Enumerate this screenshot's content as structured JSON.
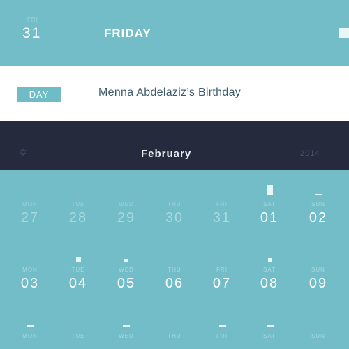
{
  "header": {
    "mini_label": "FRI",
    "date": "31",
    "weekday": "FRIDAY"
  },
  "event": {
    "tag": "DAY",
    "title": "Menna Abdelaziz’s Birthday"
  },
  "month": {
    "name": "February",
    "year": "2014",
    "icon": "star-icon"
  },
  "calendar": {
    "row1": [
      {
        "dow": "MON",
        "num": "27"
      },
      {
        "dow": "TUE",
        "num": "28"
      },
      {
        "dow": "WED",
        "num": "29"
      },
      {
        "dow": "THU",
        "num": "30"
      },
      {
        "dow": "FRI",
        "num": "31"
      },
      {
        "dow": "SAT",
        "num": "01"
      },
      {
        "dow": "SUN",
        "num": "02"
      }
    ],
    "row2": [
      {
        "dow": "MON",
        "num": "03"
      },
      {
        "dow": "TUE",
        "num": "04"
      },
      {
        "dow": "WED",
        "num": "05"
      },
      {
        "dow": "THU",
        "num": "06"
      },
      {
        "dow": "FRI",
        "num": "07"
      },
      {
        "dow": "SAT",
        "num": "08"
      },
      {
        "dow": "SUN",
        "num": "09"
      }
    ],
    "row3_dow": [
      "MON",
      "TUE",
      "WED",
      "THU",
      "FRI",
      "SAT",
      "SUN"
    ]
  },
  "colors": {
    "accent": "#72bdc7",
    "dark": "#252a3c",
    "event_bg": "#ffffff",
    "text_dark": "#3b5b6c"
  }
}
